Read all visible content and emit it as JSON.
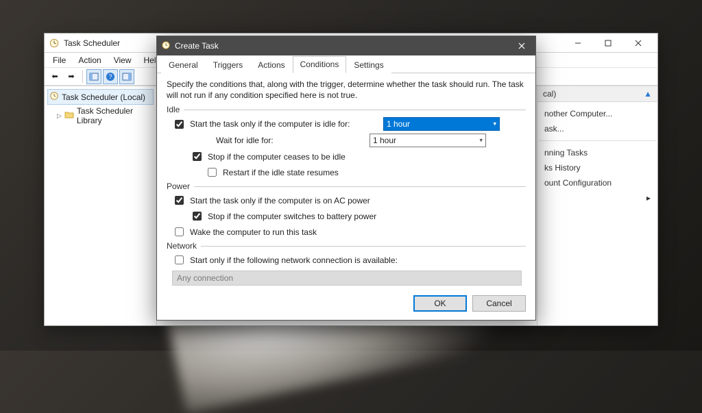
{
  "parent": {
    "title": "Task Scheduler",
    "menus": [
      "File",
      "Action",
      "View",
      "Help"
    ],
    "tree": {
      "root": "Task Scheduler (Local)",
      "child": "Task Scheduler Library"
    },
    "actions": {
      "groupTitleSuffix": "cal)",
      "items": [
        "nother Computer...",
        "ask...",
        "",
        "nning Tasks",
        "ks History",
        "ount Configuration"
      ]
    }
  },
  "dialog": {
    "title": "Create Task",
    "tabs": [
      "General",
      "Triggers",
      "Actions",
      "Conditions",
      "Settings"
    ],
    "activeTab": "Conditions",
    "description": "Specify the conditions that, along with the trigger, determine whether the task should run.  The task will not run  if any condition specified here is not true.",
    "groups": {
      "idle": {
        "label": "Idle",
        "startOnlyIfIdle": {
          "checked": true,
          "label": "Start the task only if the computer is idle for:"
        },
        "idleForValue": "1 hour",
        "waitForIdleLabel": "Wait for idle for:",
        "waitForIdleValue": "1 hour",
        "stopIfCeases": {
          "checked": true,
          "label": "Stop if the computer ceases to be idle"
        },
        "restartIfResumes": {
          "checked": false,
          "label": "Restart if the idle state resumes"
        }
      },
      "power": {
        "label": "Power",
        "startOnAC": {
          "checked": true,
          "label": "Start the task only if the computer is on AC power"
        },
        "stopOnBattery": {
          "checked": true,
          "label": "Stop if the computer switches to battery power"
        },
        "wakeToRun": {
          "checked": false,
          "label": "Wake the computer to run this task"
        }
      },
      "network": {
        "label": "Network",
        "startOnlyIfNetwork": {
          "checked": false,
          "label": "Start only if the following network connection is available:"
        },
        "connectionValue": "Any connection"
      }
    },
    "buttons": {
      "ok": "OK",
      "cancel": "Cancel"
    }
  }
}
